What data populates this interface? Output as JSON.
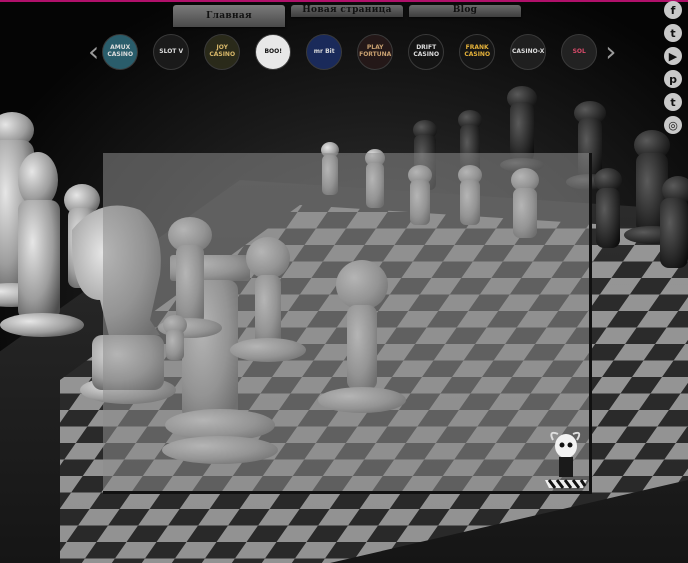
{
  "nav": {
    "tabs": [
      {
        "label": "Главная",
        "active": true
      },
      {
        "label": "Новая страница",
        "active": false
      },
      {
        "label": "Blog",
        "active": false
      }
    ]
  },
  "carousel": {
    "prev_icon": "chevron-left-icon",
    "next_icon": "chevron-right-icon",
    "logos": [
      {
        "label": "AMUX CASINO",
        "bg": "#2a5d6b"
      },
      {
        "label": "SLOT V",
        "bg": "#1a1a1a"
      },
      {
        "label": "JOY CASINO",
        "bg": "#2a2a1a"
      },
      {
        "label": "BOO!",
        "bg": "#1d1d1d"
      },
      {
        "label": "mr Bit",
        "bg": "#1a2a5a"
      },
      {
        "label": "PLAY FORTUNA",
        "bg": "#241818"
      },
      {
        "label": "DRIFT CASINO",
        "bg": "#141414"
      },
      {
        "label": "FRANK CASINO",
        "bg": "#151515"
      },
      {
        "label": "CASINO-X",
        "bg": "#1f1f1f"
      },
      {
        "label": "SOL",
        "bg": "#222"
      }
    ]
  },
  "social": {
    "items": [
      {
        "name": "facebook",
        "glyph": "f"
      },
      {
        "name": "twitter",
        "glyph": "t"
      },
      {
        "name": "youtube",
        "glyph": "▶"
      },
      {
        "name": "pinterest",
        "glyph": "p"
      },
      {
        "name": "tumblr",
        "glyph": "t"
      },
      {
        "name": "instagram",
        "glyph": "◎"
      }
    ]
  },
  "colors": {
    "accent_line": "#b0106a"
  }
}
